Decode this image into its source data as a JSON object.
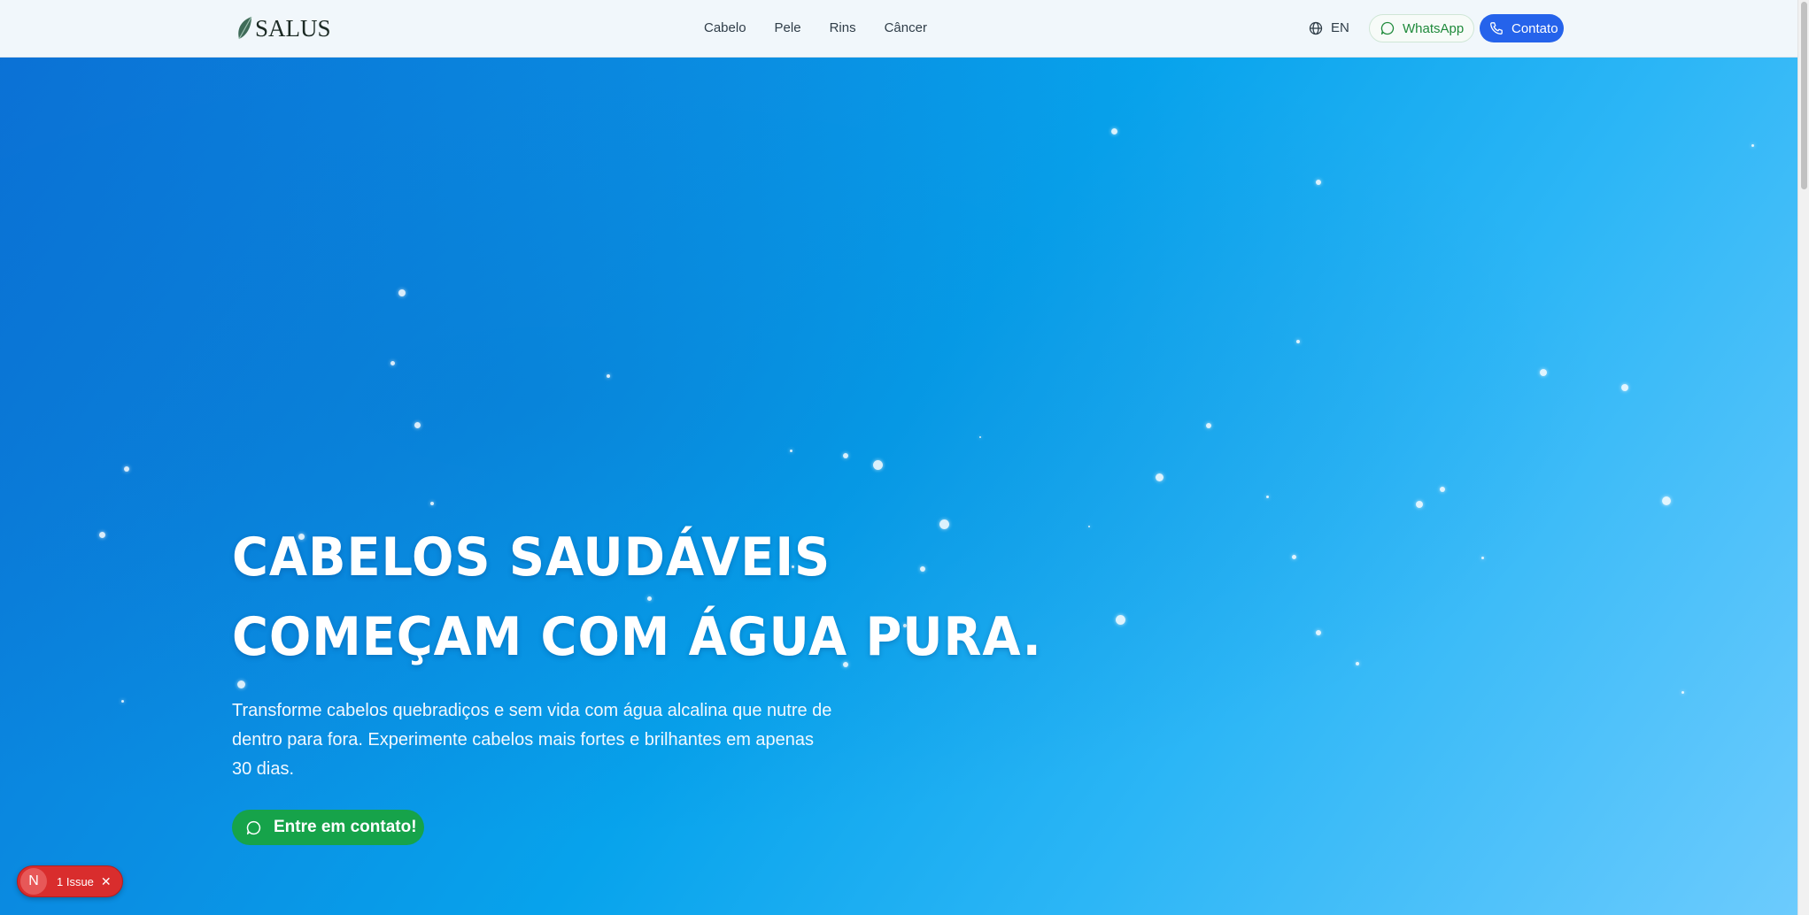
{
  "brand": {
    "name": "SALUS"
  },
  "nav": {
    "items": [
      "Cabelo",
      "Pele",
      "Rins",
      "Câncer"
    ]
  },
  "header_actions": {
    "language": "EN",
    "whatsapp_label": "WhatsApp",
    "contact_label": "Contato"
  },
  "hero": {
    "title_line1": "CABELOS SAUDÁVEIS",
    "title_line2": "COMEÇAM COM ÁGUA PURA.",
    "subtitle": "Transforme cabelos quebradiços e sem vida com água alcalina que nutre de dentro para fora. Experimente cabelos mais fortes e brilhantes em apenas 30 dias.",
    "cta_label": "Entre em contato!"
  },
  "issue_badge": {
    "logo": "N",
    "text": "1 Issue",
    "close": "✕"
  },
  "colors": {
    "primary_blue": "#2563eb",
    "whatsapp_green": "#16a34a",
    "hero_gradient_start": "#0b72d6",
    "hero_gradient_end": "#6ccbfd",
    "issue_red": "#d92d2d"
  },
  "icons": {
    "globe": "globe-icon",
    "whatsapp": "whatsapp-icon",
    "phone": "phone-icon",
    "chat": "chat-bubble-icon",
    "logo": "leaf-icon"
  }
}
